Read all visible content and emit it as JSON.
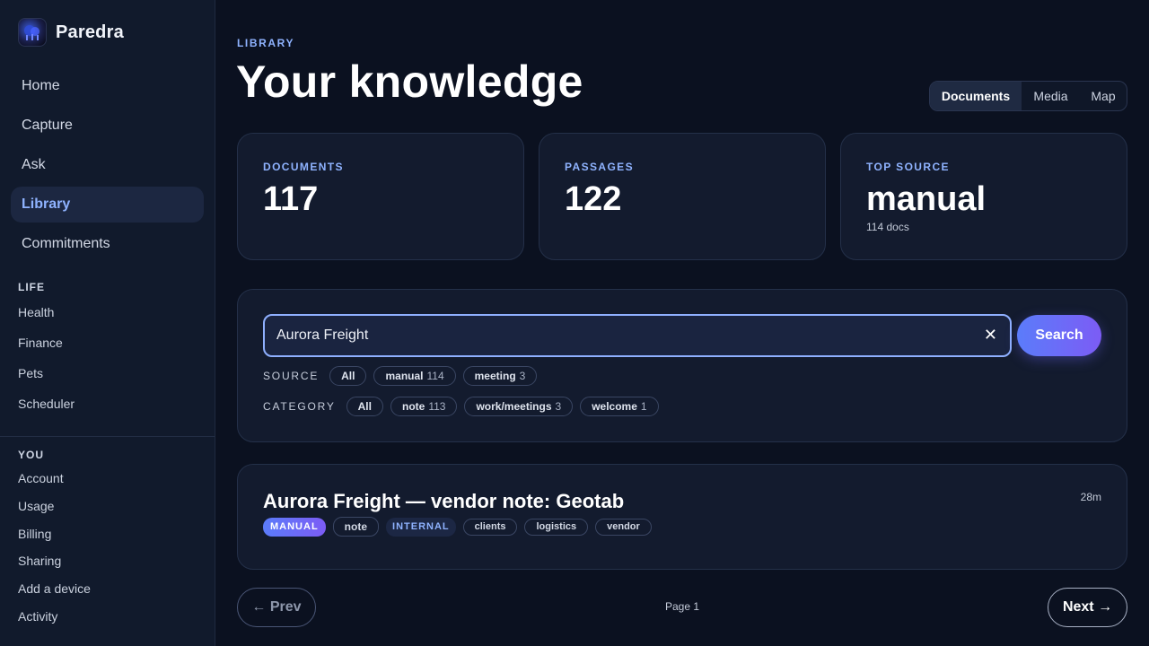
{
  "app": {
    "name": "Paredra"
  },
  "nav": {
    "items": [
      {
        "label": "Home"
      },
      {
        "label": "Capture"
      },
      {
        "label": "Ask"
      },
      {
        "label": "Library",
        "active": true
      },
      {
        "label": "Commitments"
      }
    ]
  },
  "life": {
    "label": "LIFE",
    "items": [
      {
        "label": "Health"
      },
      {
        "label": "Finance"
      },
      {
        "label": "Pets"
      },
      {
        "label": "Scheduler"
      }
    ]
  },
  "you": {
    "label": "YOU",
    "items": [
      {
        "label": "Account"
      },
      {
        "label": "Usage"
      },
      {
        "label": "Billing"
      },
      {
        "label": "Sharing"
      },
      {
        "label": "Add a device"
      },
      {
        "label": "Activity"
      }
    ]
  },
  "header": {
    "eyebrow": "LIBRARY",
    "title": "Your knowledge",
    "views": [
      {
        "label": "Documents",
        "active": true
      },
      {
        "label": "Media"
      },
      {
        "label": "Map"
      }
    ]
  },
  "stats": [
    {
      "label": "DOCUMENTS",
      "value": "117"
    },
    {
      "label": "PASSAGES",
      "value": "122"
    },
    {
      "label": "TOP SOURCE",
      "value": "manual",
      "sub": "114 docs"
    }
  ],
  "search": {
    "value": "Aurora Freight",
    "clear_icon": "close-icon",
    "button_label": "Search",
    "source": {
      "label": "SOURCE",
      "chips": [
        {
          "name": "All",
          "count": ""
        },
        {
          "name": "manual",
          "count": "114"
        },
        {
          "name": "meeting",
          "count": "3"
        }
      ]
    },
    "category": {
      "label": "CATEGORY",
      "chips": [
        {
          "name": "All",
          "count": ""
        },
        {
          "name": "note",
          "count": "113"
        },
        {
          "name": "work/meetings",
          "count": "3"
        },
        {
          "name": "welcome",
          "count": "1"
        }
      ]
    }
  },
  "result": {
    "title": "Aurora Freight — vendor note: Geotab",
    "time": "28m",
    "tags": [
      {
        "label": "MANUAL",
        "style": "primary"
      },
      {
        "label": "note",
        "style": "plain"
      },
      {
        "label": "INTERNAL",
        "style": "soft"
      },
      {
        "label": "clients",
        "style": "outline"
      },
      {
        "label": "logistics",
        "style": "outline"
      },
      {
        "label": "vendor",
        "style": "outline"
      }
    ]
  },
  "pagination": {
    "prev_label": "← Prev",
    "page_label": "Page 1",
    "next_label": "Next →"
  },
  "colors": {
    "accent": "#8fb3ff",
    "gradient_start": "#5b7cfa",
    "gradient_end": "#7c5cf5",
    "background": "#0b1120"
  }
}
